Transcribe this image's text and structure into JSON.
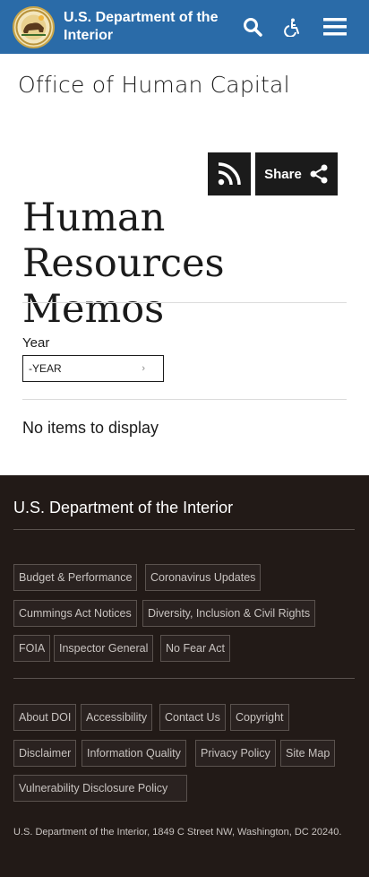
{
  "header": {
    "brand_line1": "U.S. Department of the",
    "brand_line2": "Interior",
    "search_icon": "search-icon",
    "accessibility_icon": "accessibility-icon",
    "menu_icon": "hamburger-menu-icon",
    "bg_color": "#2a6ba8"
  },
  "office_title": "Office of Human Capital",
  "actions": {
    "rss_icon": "rss-icon",
    "share_label": "Share",
    "share_icon": "share-icon"
  },
  "main": {
    "title_line1": "Human Resources",
    "title_line2": "Memos",
    "year_label": "Year",
    "year_value": "-YEAR",
    "empty_message": "No items to display"
  },
  "footer": {
    "title": "U.S. Department of the Interior",
    "links_group1": [
      "Budget & Performance",
      "Coronavirus Updates",
      "Cummings Act Notices",
      "Diversity, Inclusion & Civil Rights",
      "FOIA",
      "Inspector General",
      "No Fear Act"
    ],
    "links_group2": [
      "About DOI",
      "Accessibility",
      "Contact Us",
      "Copyright",
      "Disclaimer",
      "Information Quality",
      "Privacy Policy",
      "Site Map",
      "Vulnerability Disclosure Policy"
    ],
    "address": "U.S. Department of the Interior, 1849 C Street NW, Washington, DC 20240.",
    "bg_color": "#221a17"
  }
}
